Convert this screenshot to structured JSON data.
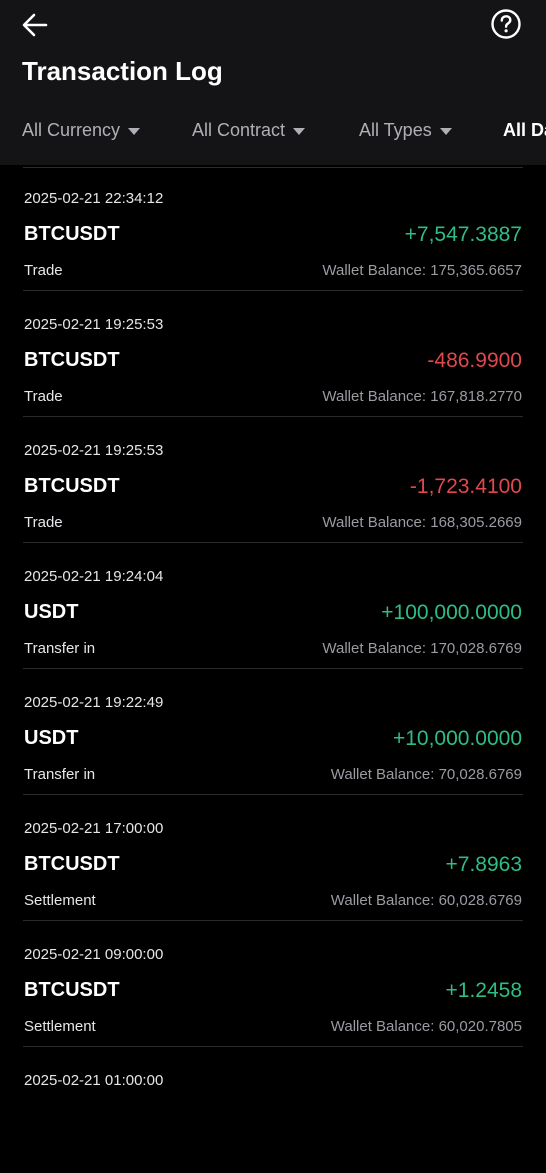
{
  "header": {
    "title": "Transaction Log",
    "back_icon": "arrow-left-icon",
    "help_icon": "help-circle-icon"
  },
  "filters": [
    {
      "label": "All Currency",
      "active": false
    },
    {
      "label": "All Contract",
      "active": false
    },
    {
      "label": "All Types",
      "active": false
    },
    {
      "label": "All Date",
      "active": true
    }
  ],
  "balance_label": "Wallet Balance: ",
  "colors": {
    "positive": "#2ebd85",
    "negative": "#e0484d",
    "header_bg": "#141416",
    "page_bg": "#000000"
  },
  "transactions": [
    {
      "time": "2025-02-21 22:34:12",
      "symbol": "BTCUSDT",
      "amount": "+7,547.3887",
      "sign": "pos",
      "type": "Trade",
      "balance": "175,365.6657"
    },
    {
      "time": "2025-02-21 19:25:53",
      "symbol": "BTCUSDT",
      "amount": "-486.9900",
      "sign": "neg",
      "type": "Trade",
      "balance": "167,818.2770"
    },
    {
      "time": "2025-02-21 19:25:53",
      "symbol": "BTCUSDT",
      "amount": "-1,723.4100",
      "sign": "neg",
      "type": "Trade",
      "balance": "168,305.2669"
    },
    {
      "time": "2025-02-21 19:24:04",
      "symbol": "USDT",
      "amount": "+100,000.0000",
      "sign": "pos",
      "type": "Transfer in",
      "balance": "170,028.6769"
    },
    {
      "time": "2025-02-21 19:22:49",
      "symbol": "USDT",
      "amount": "+10,000.0000",
      "sign": "pos",
      "type": "Transfer in",
      "balance": "70,028.6769"
    },
    {
      "time": "2025-02-21 17:00:00",
      "symbol": "BTCUSDT",
      "amount": "+7.8963",
      "sign": "pos",
      "type": "Settlement",
      "balance": "60,028.6769"
    },
    {
      "time": "2025-02-21 09:00:00",
      "symbol": "BTCUSDT",
      "amount": "+1.2458",
      "sign": "pos",
      "type": "Settlement",
      "balance": "60,020.7805"
    },
    {
      "time": "2025-02-21 01:00:00",
      "symbol": "",
      "amount": "",
      "sign": "pos",
      "type": "",
      "balance": ""
    }
  ]
}
